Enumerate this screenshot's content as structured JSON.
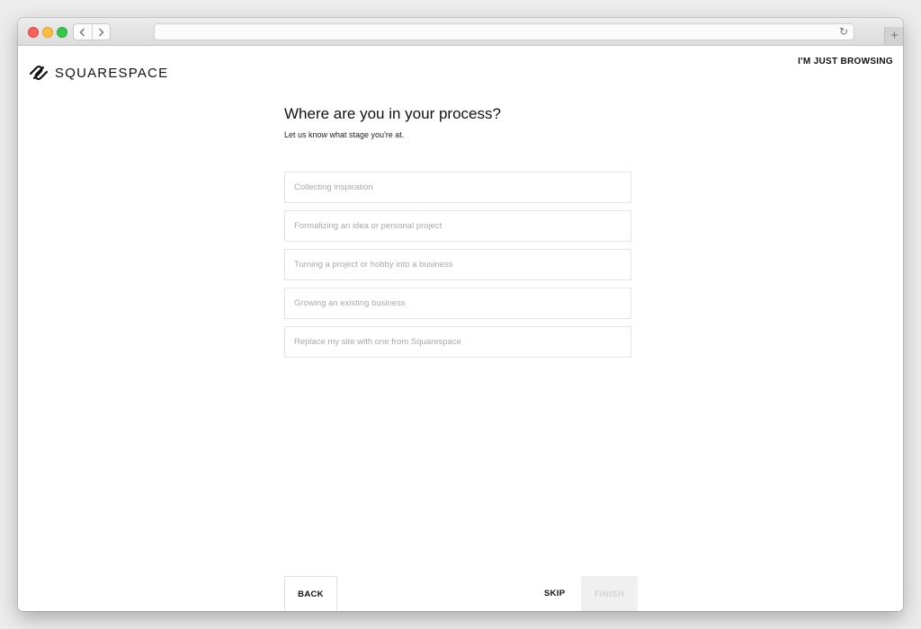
{
  "browser": {
    "nav_back_icon": "chevron-left-icon",
    "nav_forward_icon": "chevron-right-icon",
    "reload_glyph": "↻",
    "new_tab_glyph": "+",
    "url": ""
  },
  "brand": {
    "name": "SQUARESPACE",
    "logo_icon": "squarespace-logo-icon"
  },
  "header": {
    "browse_link": "I'M JUST BROWSING"
  },
  "question": {
    "title": "Where are you in your process?",
    "subtitle": "Let us know what stage you're at."
  },
  "options": [
    {
      "label": "Collecting inspiration"
    },
    {
      "label": "Formalizing an idea or personal project"
    },
    {
      "label": "Turning a project or hobby into a business"
    },
    {
      "label": "Growing an existing business"
    },
    {
      "label": "Replace my site with one from Squarespace"
    }
  ],
  "footer": {
    "back_label": "BACK",
    "skip_label": "SKIP",
    "finish_label": "FINISH"
  },
  "colors": {
    "accent_text": "#111111",
    "option_text": "#a9a9a9",
    "option_border": "#e4e4e4",
    "finish_bg": "#f0f0f0",
    "finish_text": "#d4d4d4"
  }
}
